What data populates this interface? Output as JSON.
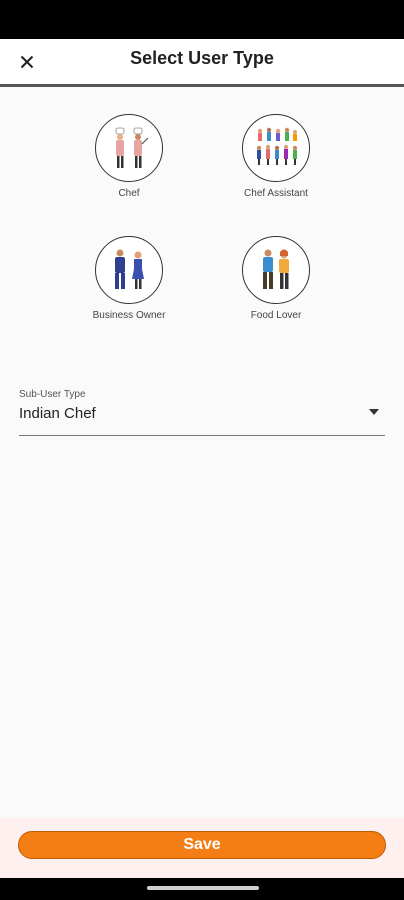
{
  "header": {
    "title": "Select User Type",
    "close_icon": "close-icon"
  },
  "user_types": [
    {
      "label": "Chef",
      "icon": "chef-illustration"
    },
    {
      "label": "Chef Assistant",
      "icon": "chef-assistant-illustration"
    },
    {
      "label": "Business Owner",
      "icon": "business-owner-illustration"
    },
    {
      "label": "Food Lover",
      "icon": "food-lover-illustration"
    }
  ],
  "sub_user_type": {
    "label": "Sub-User Type",
    "value": "Indian Chef",
    "icon": "dropdown-arrow-icon"
  },
  "footer": {
    "save_label": "Save"
  },
  "colors": {
    "accent": "#f47d14",
    "footer_background": "#fdf0ee",
    "background": "#fafafa"
  }
}
